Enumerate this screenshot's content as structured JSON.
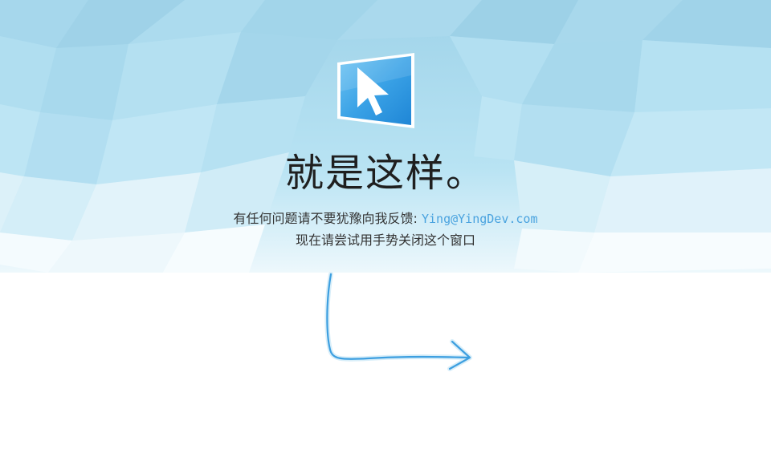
{
  "title": "就是这样。",
  "feedback": {
    "prefix": "有任何问题请不要犹豫向我反馈: ",
    "email": "Ying@YingDev.com"
  },
  "instruction": "现在请尝试用手势关闭这个窗口",
  "icons": {
    "logo": "cursor-monitor-icon",
    "gesture": "gesture-arrow-icon"
  },
  "colors": {
    "accent": "#4aa3df",
    "sky": "#a9dbef",
    "text": "#1f1f1f"
  }
}
